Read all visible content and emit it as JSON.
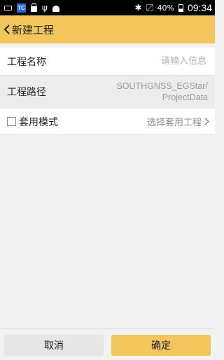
{
  "status_bar": {
    "tc_label": "TC",
    "battery": "40%",
    "time": "09:34"
  },
  "header": {
    "title": "新建工程"
  },
  "form": {
    "name_label": "工程名称",
    "name_placeholder": "请输入信息",
    "path_label": "工程路径",
    "path_value_line1": "SOUTHGNSS_EGStar/",
    "path_value_line2": "ProjectData",
    "template_label": "套用模式",
    "template_checked": false,
    "template_select": "选择套用工程"
  },
  "footer": {
    "cancel": "取消",
    "confirm": "确定"
  },
  "colors": {
    "accent": "#f2c65a",
    "background": "#f2f2f2"
  }
}
